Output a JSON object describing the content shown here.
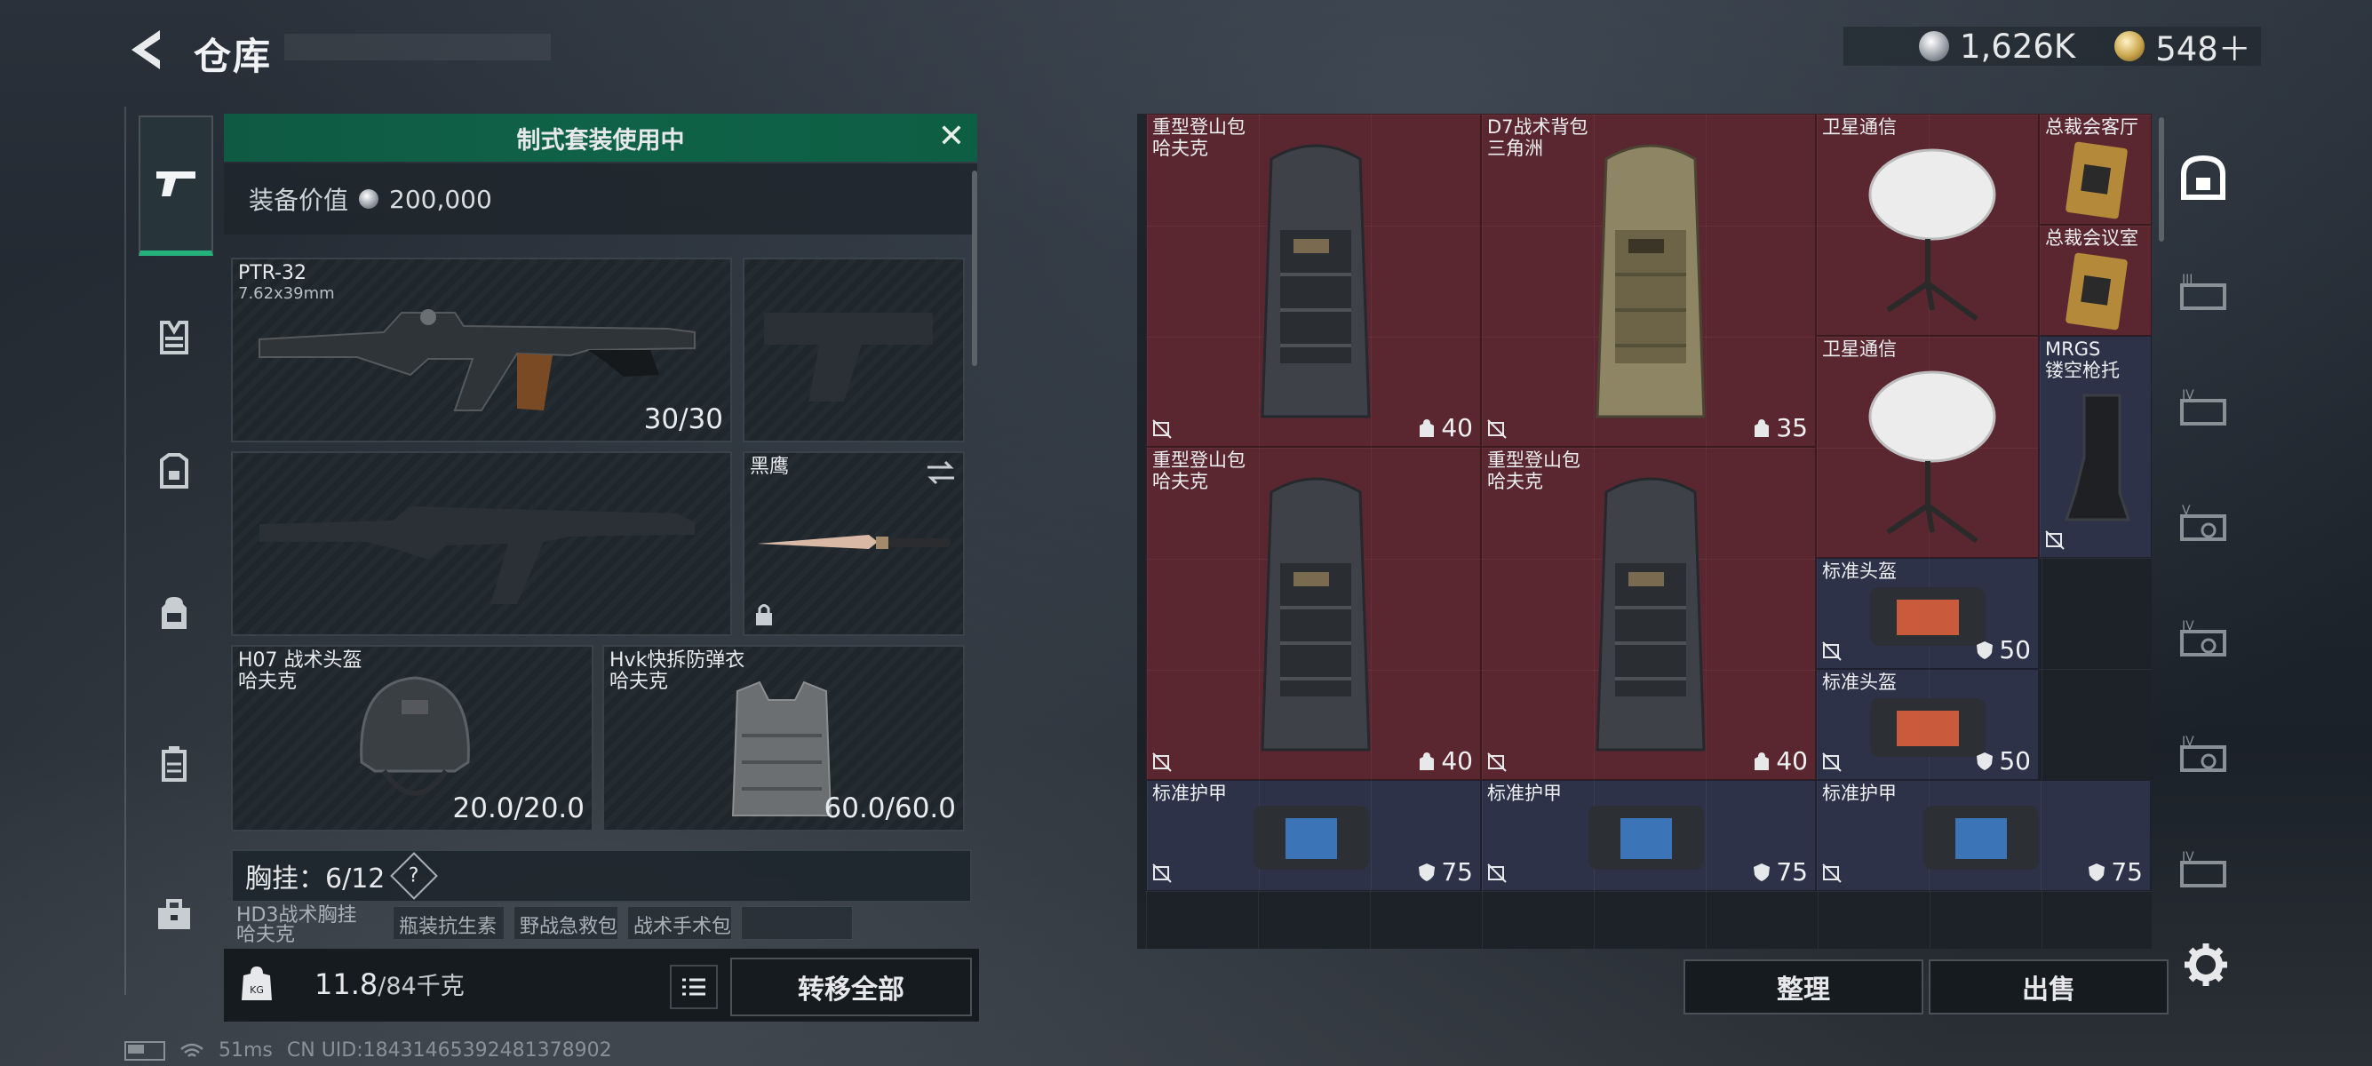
{
  "header": {
    "title": "仓库",
    "currency_silver": "1,626K",
    "currency_gold": "548＋"
  },
  "loadout": {
    "banner": "制式套装使用中",
    "value_label": "装备价值",
    "value": "200,000",
    "primary": {
      "name": "PTR-32",
      "caliber": "7.62x39mm",
      "ammo": "30/30"
    },
    "melee": {
      "name": "黑鹰"
    },
    "helmet": {
      "name": "H07 战术头盔",
      "brand": "哈夫克",
      "durability": "20.0/20.0"
    },
    "armor": {
      "name": "Hvk快拆防弹衣",
      "brand": "哈夫克",
      "durability": "60.0/60.0"
    },
    "chest": {
      "label": "胸挂：6/12",
      "help": "?"
    },
    "chest_items": [
      "HD3战术胸挂",
      "哈夫克",
      "瓶装抗生素",
      "野战急救包",
      "战术手术包"
    ],
    "weight": "11.8",
    "weight_max": "/84千克",
    "transfer_all": "转移全部"
  },
  "stash": {
    "items": [
      {
        "line1": "重型登山包",
        "line2": "哈夫克",
        "value": "40"
      },
      {
        "line1": "D7战术背包",
        "line2": "三角洲",
        "value": "35"
      },
      {
        "line1": "卫星通信",
        "line2": ""
      },
      {
        "line1": "总裁会客厅",
        "line2": ""
      },
      {
        "line1": "总裁会议室",
        "line2": ""
      },
      {
        "line1": "卫星通信",
        "line2": ""
      },
      {
        "line1": "MRGS",
        "line2": "镂空枪托"
      },
      {
        "line1": "重型登山包",
        "line2": "哈夫克",
        "value": "40"
      },
      {
        "line1": "重型登山包",
        "line2": "哈夫克",
        "value": "40"
      },
      {
        "line1": "标准头盔",
        "line2": "",
        "value": "50"
      },
      {
        "line1": "标准头盔",
        "line2": "",
        "value": "50"
      },
      {
        "line1": "标准护甲",
        "line2": "",
        "value": "75"
      },
      {
        "line1": "标准护甲",
        "line2": "",
        "value": "75"
      },
      {
        "line1": "标准护甲",
        "line2": "",
        "value": "75"
      }
    ],
    "sort": "整理",
    "sell": "出售"
  },
  "right_nav": [
    "III",
    "IV",
    "V",
    "IV",
    "IV",
    "IV"
  ],
  "status": {
    "ping": "51ms",
    "uid": "CN UID:1843146539248137890​2"
  },
  "icons": {
    "back": "back-arrow-icon",
    "settings": "gear-icon",
    "close": "close-icon"
  }
}
